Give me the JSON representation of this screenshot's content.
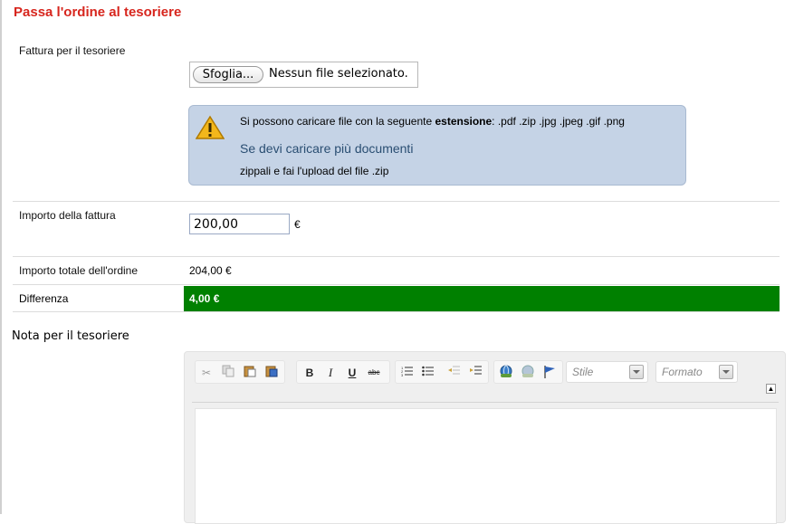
{
  "page": {
    "title": "Passa l'ordine al tesoriere"
  },
  "invoice_file": {
    "label": "Fattura per il tesoriere",
    "browse_label": "Sfoglia...",
    "status": "Nessun file selezionato."
  },
  "info": {
    "icon": "warning-icon",
    "line1_prefix": "Si possono caricare file con la seguente ",
    "line1_bold": "estensione",
    "line1_suffix": ":  .pdf .zip .jpg .jpeg .gif .png",
    "link": "Se devi caricare più documenti",
    "line3": "zippali e fai l'upload del file .zip"
  },
  "amount": {
    "label": "Importo della fattura",
    "value": "200,00",
    "currency": "€"
  },
  "total": {
    "label": "Importo totale dell'ordine",
    "value": "204,00 €"
  },
  "difference": {
    "label": "Differenza",
    "value": "4,00 €",
    "color": "#008000"
  },
  "note": {
    "label": "Nota per il tesoriere",
    "toolbar": {
      "cut": "cut-icon",
      "copy": "copy-icon",
      "paste": "paste-icon",
      "paste_word": "paste-word-icon",
      "bold": "B",
      "italic": "I",
      "underline": "U",
      "strike": "abc",
      "style_placeholder": "Stile",
      "format_placeholder": "Formato"
    }
  },
  "colors": {
    "title": "#d7261e",
    "info_bg": "#c5d3e6",
    "link": "#2a4e72"
  }
}
